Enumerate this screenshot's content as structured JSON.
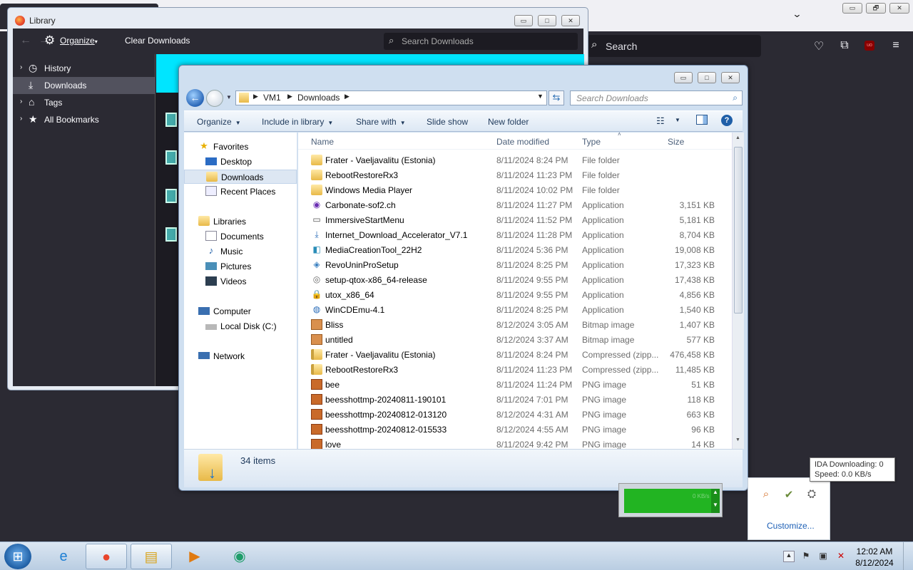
{
  "firefox": {
    "search_placeholder": "Search",
    "window_buttons": [
      "▭",
      "🗗",
      "✕"
    ]
  },
  "library": {
    "title": "Library",
    "toolbar": {
      "organize": "Organize",
      "clear_downloads": "Clear Downloads",
      "search_placeholder": "Search Downloads"
    },
    "sidebar": [
      {
        "label": "History",
        "icon": "clock-icon"
      },
      {
        "label": "Downloads",
        "icon": "download-icon",
        "selected": true
      },
      {
        "label": "Tags",
        "icon": "tag-icon"
      },
      {
        "label": "All Bookmarks",
        "icon": "star-icon"
      }
    ]
  },
  "explorer": {
    "breadcrumb": [
      "VM1",
      "Downloads"
    ],
    "search_placeholder": "Search Downloads",
    "commands": [
      "Organize",
      "Include in library",
      "Share with",
      "Slide show",
      "New folder"
    ],
    "nav": {
      "favorites": "Favorites",
      "desktop": "Desktop",
      "downloads": "Downloads",
      "recent": "Recent Places",
      "libraries": "Libraries",
      "documents": "Documents",
      "music": "Music",
      "pictures": "Pictures",
      "videos": "Videos",
      "computer": "Computer",
      "local_disk": "Local Disk (C:)",
      "network": "Network"
    },
    "columns": [
      "Name",
      "Date modified",
      "Type",
      "Size"
    ],
    "files": [
      {
        "name": "Frater - Vaeljavalitu (Estonia)",
        "date": "8/11/2024 8:24 PM",
        "type": "File folder",
        "size": "",
        "icon": "folder"
      },
      {
        "name": "RebootRestoreRx3",
        "date": "8/11/2024 11:23 PM",
        "type": "File folder",
        "size": "",
        "icon": "folder"
      },
      {
        "name": "Windows Media Player",
        "date": "8/11/2024 10:02 PM",
        "type": "File folder",
        "size": "",
        "icon": "folder"
      },
      {
        "name": "Carbonate-sof2.ch",
        "date": "8/11/2024 11:27 PM",
        "type": "Application",
        "size": "3,151 KB",
        "icon": "app-purple"
      },
      {
        "name": "ImmersiveStartMenu",
        "date": "8/11/2024 11:52 PM",
        "type": "Application",
        "size": "5,181 KB",
        "icon": "app-window"
      },
      {
        "name": "Internet_Download_Accelerator_V7.1",
        "date": "8/11/2024 11:28 PM",
        "type": "Application",
        "size": "8,704 KB",
        "icon": "app-download"
      },
      {
        "name": "MediaCreationTool_22H2",
        "date": "8/11/2024 5:36 PM",
        "type": "Application",
        "size": "19,008 KB",
        "icon": "app-media"
      },
      {
        "name": "RevoUninProSetup",
        "date": "8/11/2024 8:25 PM",
        "type": "Application",
        "size": "17,323 KB",
        "icon": "app-revo"
      },
      {
        "name": "setup-qtox-x86_64-release",
        "date": "8/11/2024 9:55 PM",
        "type": "Application",
        "size": "17,438 KB",
        "icon": "app-setup"
      },
      {
        "name": "utox_x86_64",
        "date": "8/11/2024 9:55 PM",
        "type": "Application",
        "size": "4,856 KB",
        "icon": "app-lock"
      },
      {
        "name": "WinCDEmu-4.1",
        "date": "8/11/2024 8:25 PM",
        "type": "Application",
        "size": "1,540 KB",
        "icon": "app-globe"
      },
      {
        "name": "Bliss",
        "date": "8/12/2024 3:05 AM",
        "type": "Bitmap image",
        "size": "1,407 KB",
        "icon": "bmp"
      },
      {
        "name": "untitled",
        "date": "8/12/2024 3:37 AM",
        "type": "Bitmap image",
        "size": "577 KB",
        "icon": "bmp"
      },
      {
        "name": "Frater - Vaeljavalitu (Estonia)",
        "date": "8/11/2024 8:24 PM",
        "type": "Compressed (zipp...",
        "size": "476,458 KB",
        "icon": "zip"
      },
      {
        "name": "RebootRestoreRx3",
        "date": "8/11/2024 11:23 PM",
        "type": "Compressed (zipp...",
        "size": "11,485 KB",
        "icon": "zip"
      },
      {
        "name": "bee",
        "date": "8/11/2024 11:24 PM",
        "type": "PNG image",
        "size": "51 KB",
        "icon": "png"
      },
      {
        "name": "beesshottmp-20240811-190101",
        "date": "8/11/2024 7:01 PM",
        "type": "PNG image",
        "size": "118 KB",
        "icon": "png"
      },
      {
        "name": "beesshottmp-20240812-013120",
        "date": "8/12/2024 4:31 AM",
        "type": "PNG image",
        "size": "663 KB",
        "icon": "png"
      },
      {
        "name": "beesshottmp-20240812-015533",
        "date": "8/12/2024 4:55 AM",
        "type": "PNG image",
        "size": "96 KB",
        "icon": "png"
      },
      {
        "name": "love",
        "date": "8/11/2024 9:42 PM",
        "type": "PNG image",
        "size": "14 KB",
        "icon": "png"
      }
    ],
    "status": "34 items"
  },
  "tooltip": {
    "line1": "IDA  Downloading: 0",
    "line2": "Speed: 0.0 KB/s"
  },
  "ida_speed": "0 KB/s",
  "tray_popup": {
    "customize": "Customize..."
  },
  "clock": {
    "time": "12:02 AM",
    "date": "8/12/2024"
  }
}
